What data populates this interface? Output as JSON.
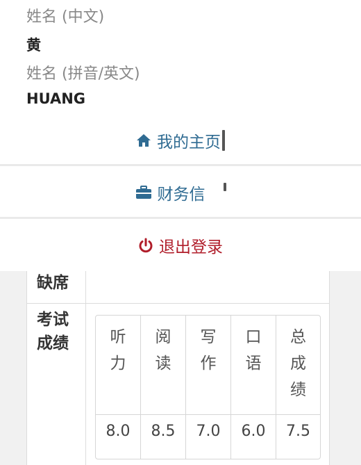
{
  "profile": {
    "name_cn_label": "姓名 (中文)",
    "name_cn_value": "黄",
    "name_en_label": "姓名 (拼音/英文)",
    "name_en_value": "HUANG"
  },
  "menu": {
    "home": {
      "label": "我的主页",
      "icon": "home-icon"
    },
    "finance": {
      "label": "财务信",
      "icon": "briefcase-icon"
    },
    "logout": {
      "label": "退出登录",
      "icon": "power-icon"
    }
  },
  "table": {
    "absent_label": "缺席",
    "scores_label": "考试\n成绩",
    "columns": [
      {
        "header": "听\n力",
        "value": "8.0"
      },
      {
        "header": "阅\n读",
        "value": "8.5"
      },
      {
        "header": "写\n作",
        "value": "7.0"
      },
      {
        "header": "口\n语",
        "value": "6.0"
      },
      {
        "header": "总\n成\n绩",
        "value": "7.5"
      }
    ]
  },
  "colors": {
    "link": "#2f6b92",
    "danger": "#b01d2a"
  }
}
